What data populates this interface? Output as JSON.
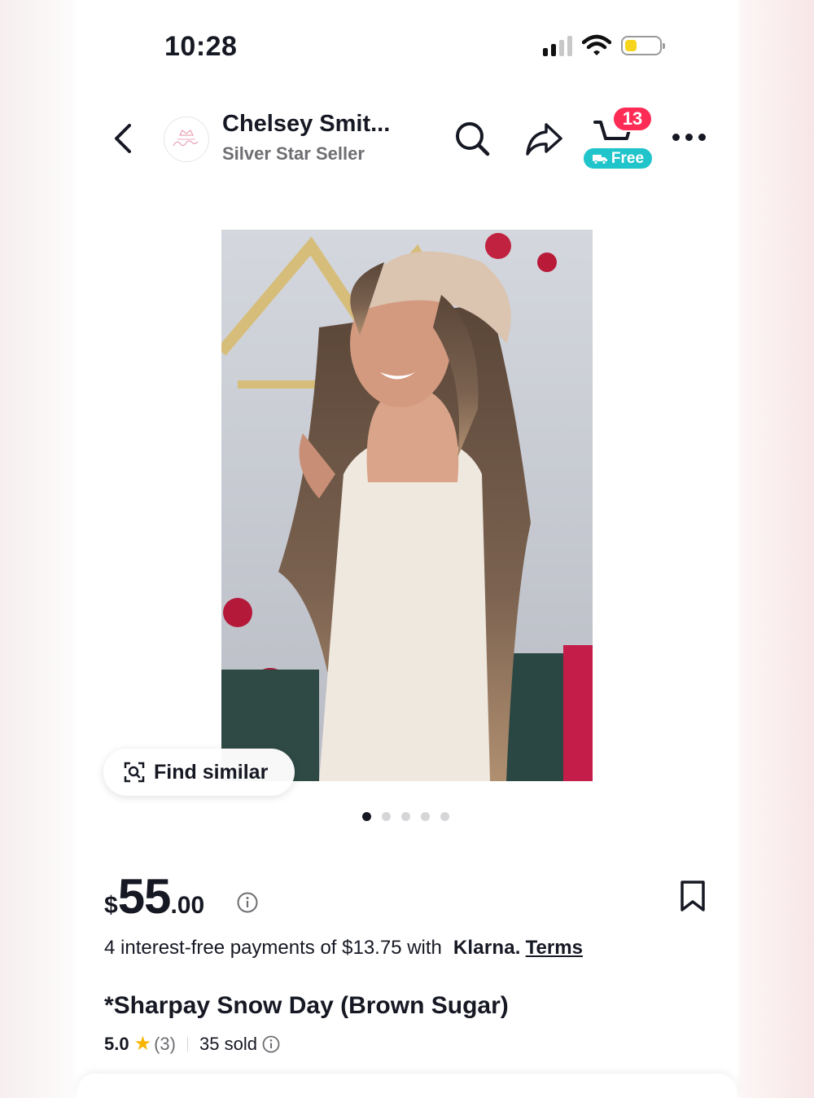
{
  "status_bar": {
    "time": "10:28",
    "battery_color": "#f7d51c"
  },
  "header": {
    "seller_name": "Chelsey Smit...",
    "seller_badge": "Silver Star Seller",
    "cart_count": "13",
    "free_shipping_label": "Free",
    "icons": [
      "back-arrow-icon",
      "search-icon",
      "share-icon",
      "cart-icon",
      "more-icon"
    ]
  },
  "gallery": {
    "find_similar_label": "Find similar",
    "image_count": 5,
    "active_index": 0
  },
  "product": {
    "price_currency": "$",
    "price_whole": "55",
    "price_decimal": ".00",
    "installments_text": "4 interest-free payments of $13.75 with",
    "installments_brand": "Klarna.",
    "installments_terms": "Terms",
    "title": "*Sharpay Snow Day (Brown Sugar)",
    "rating": "5.0",
    "review_count": "(3)",
    "sold": "35 sold"
  },
  "colors": {
    "accent_red": "#fe2c55",
    "teal": "#20c4cb",
    "star": "#f8b500"
  }
}
